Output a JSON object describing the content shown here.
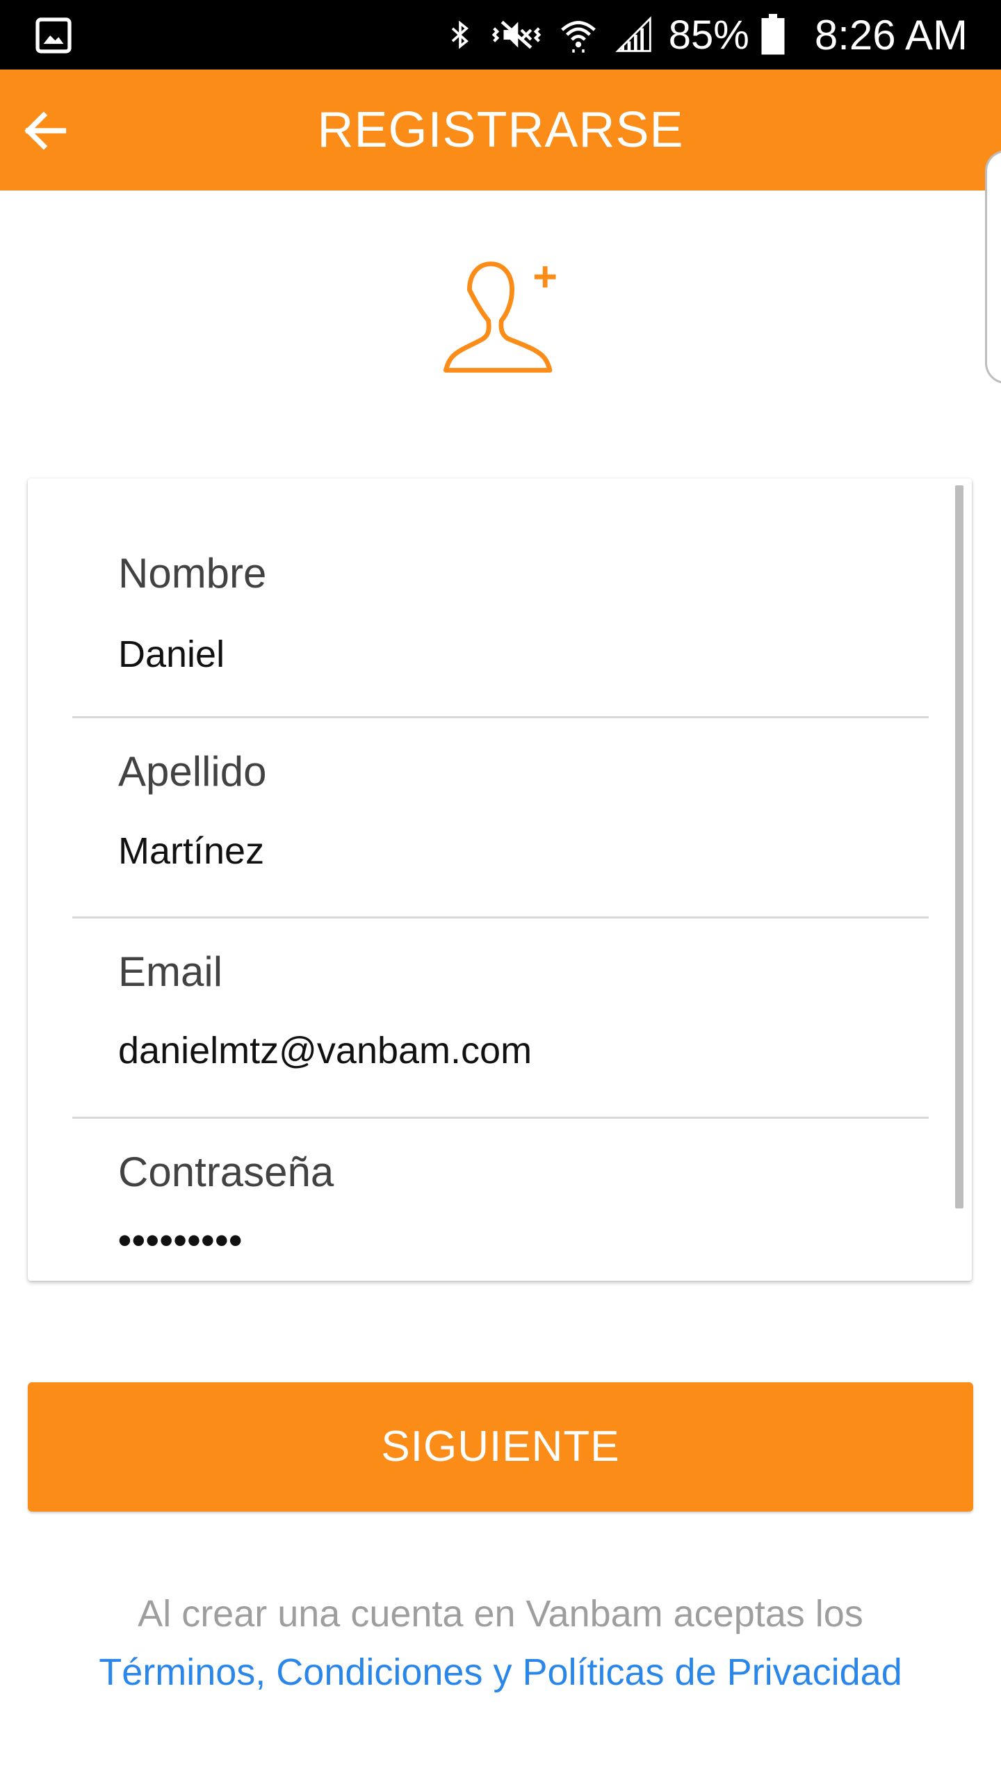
{
  "status_bar": {
    "battery_percent": "85%",
    "time": "8:26 AM",
    "icons": [
      "gallery-icon",
      "bluetooth-icon",
      "vibrate-icon",
      "wifi-icon",
      "signal-icon",
      "battery-icon"
    ]
  },
  "app_bar": {
    "title": "REGISTRARSE",
    "back_icon": "arrow-back-icon"
  },
  "header_icon": "add-user-icon",
  "form": {
    "fields": [
      {
        "label": "Nombre",
        "value": "Daniel"
      },
      {
        "label": "Apellido",
        "value": "Martínez"
      },
      {
        "label": "Email",
        "value": "danielmtz@vanbam.com"
      },
      {
        "label": "Contraseña",
        "value": "•••••••••"
      }
    ]
  },
  "next_button": {
    "label": "SIGUIENTE"
  },
  "terms": {
    "text": "Al crear una cuenta en Vanbam aceptas los",
    "link": "Términos, Condiciones y Políticas de Privacidad"
  },
  "colors": {
    "accent": "#FB8C17",
    "link": "#2A86E8",
    "status_bar": "#000000"
  }
}
